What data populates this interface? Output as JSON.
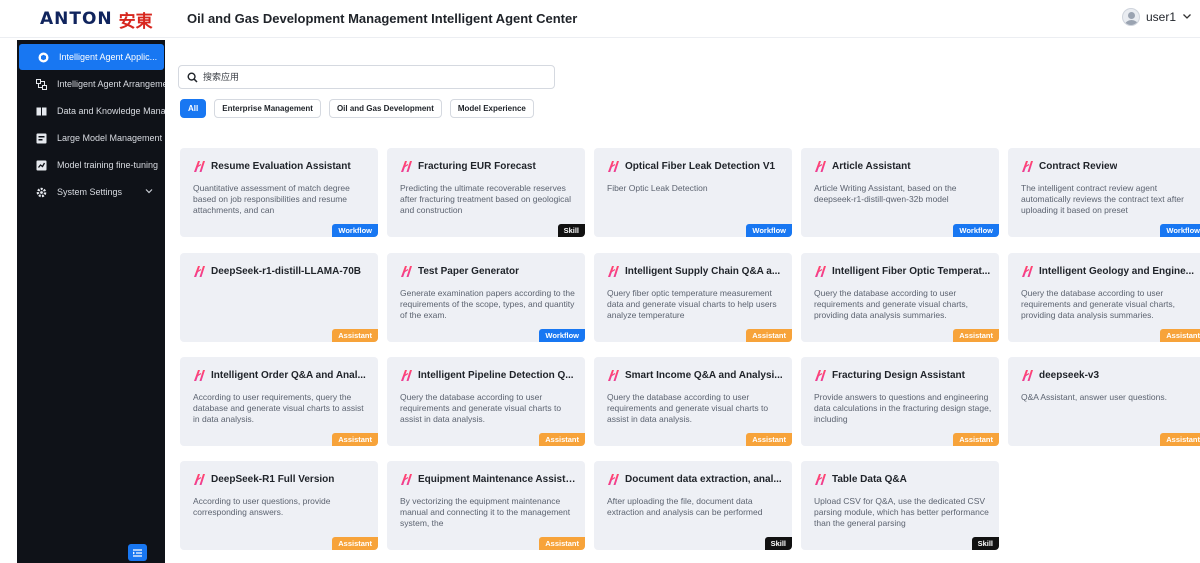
{
  "brand": {
    "logo_en": "ANTON",
    "logo_cn": "安東"
  },
  "header": {
    "title": "Oil and Gas Development Management Intelligent Agent Center",
    "username": "user1"
  },
  "sidebar": {
    "items": [
      {
        "label": "Intelligent Agent Applic...",
        "icon": "agent-app-icon",
        "active": true
      },
      {
        "label": "Intelligent Agent Arrangement",
        "icon": "arrange-icon"
      },
      {
        "label": "Data and Knowledge Management",
        "icon": "book-icon"
      },
      {
        "label": "Large Model Management",
        "icon": "model-icon"
      },
      {
        "label": "Model training fine-tuning",
        "icon": "training-icon"
      },
      {
        "label": "System Settings",
        "icon": "gear-icon",
        "has_caret": true
      }
    ],
    "collapse_icon": "menu-collapse-icon"
  },
  "search": {
    "placeholder": "搜索应用",
    "value": ""
  },
  "filters": [
    "All",
    "Enterprise Management",
    "Oil and Gas Development",
    "Model Experience"
  ],
  "tags": {
    "workflow": "Workflow",
    "skill": "Skill",
    "assistant": "Assistant"
  },
  "colors": {
    "primary": "#1877f2",
    "sidebar": "#0f1218",
    "assistant": "#f7a33a",
    "skill": "#111111",
    "card": "#eef0f5"
  },
  "cards": [
    {
      "title": "Resume Evaluation Assistant",
      "desc": "Quantitative assessment of match degree based on job responsibilities and resume attachments, and can",
      "tag": "Workflow",
      "type": "workflow"
    },
    {
      "title": "Fracturing EUR Forecast",
      "desc": "Predicting the ultimate recoverable reserves after fracturing treatment based on geological and construction",
      "tag": "Skill",
      "type": "skill"
    },
    {
      "title": "Optical Fiber Leak Detection V1",
      "desc": "Fiber Optic Leak Detection",
      "tag": "Workflow",
      "type": "workflow"
    },
    {
      "title": "Article Assistant",
      "desc": "Article Writing Assistant, based on the deepseek-r1-distill-qwen-32b model",
      "tag": "Workflow",
      "type": "workflow"
    },
    {
      "title": "Contract Review",
      "desc": "The intelligent contract review agent automatically reviews the contract text after uploading it based on preset",
      "tag": "Workflow",
      "type": "workflow"
    },
    {
      "title": "DeepSeek-r1-distill-LLAMA-70B",
      "desc": "",
      "tag": "Assistant",
      "type": "assistant"
    },
    {
      "title": "Test Paper Generator",
      "desc": "Generate examination papers according to the requirements of the scope, types, and quantity of the exam.",
      "tag": "Workflow",
      "type": "workflow"
    },
    {
      "title": "Intelligent Supply Chain Q&A a...",
      "desc": "Query fiber optic temperature measurement data and generate visual charts to help users analyze temperature",
      "tag": "Assistant",
      "type": "assistant"
    },
    {
      "title": "Intelligent Fiber Optic Temperat...",
      "desc": "Query the database according to user requirements and generate visual charts, providing data analysis summaries.",
      "tag": "Assistant",
      "type": "assistant"
    },
    {
      "title": "Intelligent Geology and Engine...",
      "desc": "Query the database according to user requirements and generate visual charts, providing data analysis summaries.",
      "tag": "Assistant",
      "type": "assistant"
    },
    {
      "title": "Intelligent Order Q&A and Anal...",
      "desc": "According to user requirements, query the database and generate visual charts to assist in data analysis.",
      "tag": "Assistant",
      "type": "assistant"
    },
    {
      "title": "Intelligent Pipeline Detection Q...",
      "desc": "Query the database according to user requirements and generate visual charts to assist in data analysis.",
      "tag": "Assistant",
      "type": "assistant"
    },
    {
      "title": "Smart Income Q&A and Analysi...",
      "desc": "Query the database according to user requirements and generate visual charts to assist in data analysis.",
      "tag": "Assistant",
      "type": "assistant"
    },
    {
      "title": "Fracturing Design Assistant",
      "desc": "Provide answers to questions and engineering data calculations in the fracturing design stage, including",
      "tag": "Assistant",
      "type": "assistant"
    },
    {
      "title": "deepseek-v3",
      "desc": "Q&A Assistant, answer user questions.",
      "tag": "Assistant",
      "type": "assistant"
    },
    {
      "title": "DeepSeek-R1 Full Version",
      "desc": "According to user questions, provide corresponding answers.",
      "tag": "Assistant",
      "type": "assistant"
    },
    {
      "title": "Equipment Maintenance Assistant",
      "desc": "By vectorizing the equipment maintenance manual and connecting it to the management system, the",
      "tag": "Assistant",
      "type": "assistant"
    },
    {
      "title": "Document data extraction, anal...",
      "desc": "After uploading the file, document data extraction and analysis can be performed",
      "tag": "Skill",
      "type": "skill"
    },
    {
      "title": "Table Data Q&A",
      "desc": "Upload CSV for Q&A, use the dedicated CSV parsing module, which has better performance than the general parsing",
      "tag": "Skill",
      "type": "skill"
    }
  ]
}
